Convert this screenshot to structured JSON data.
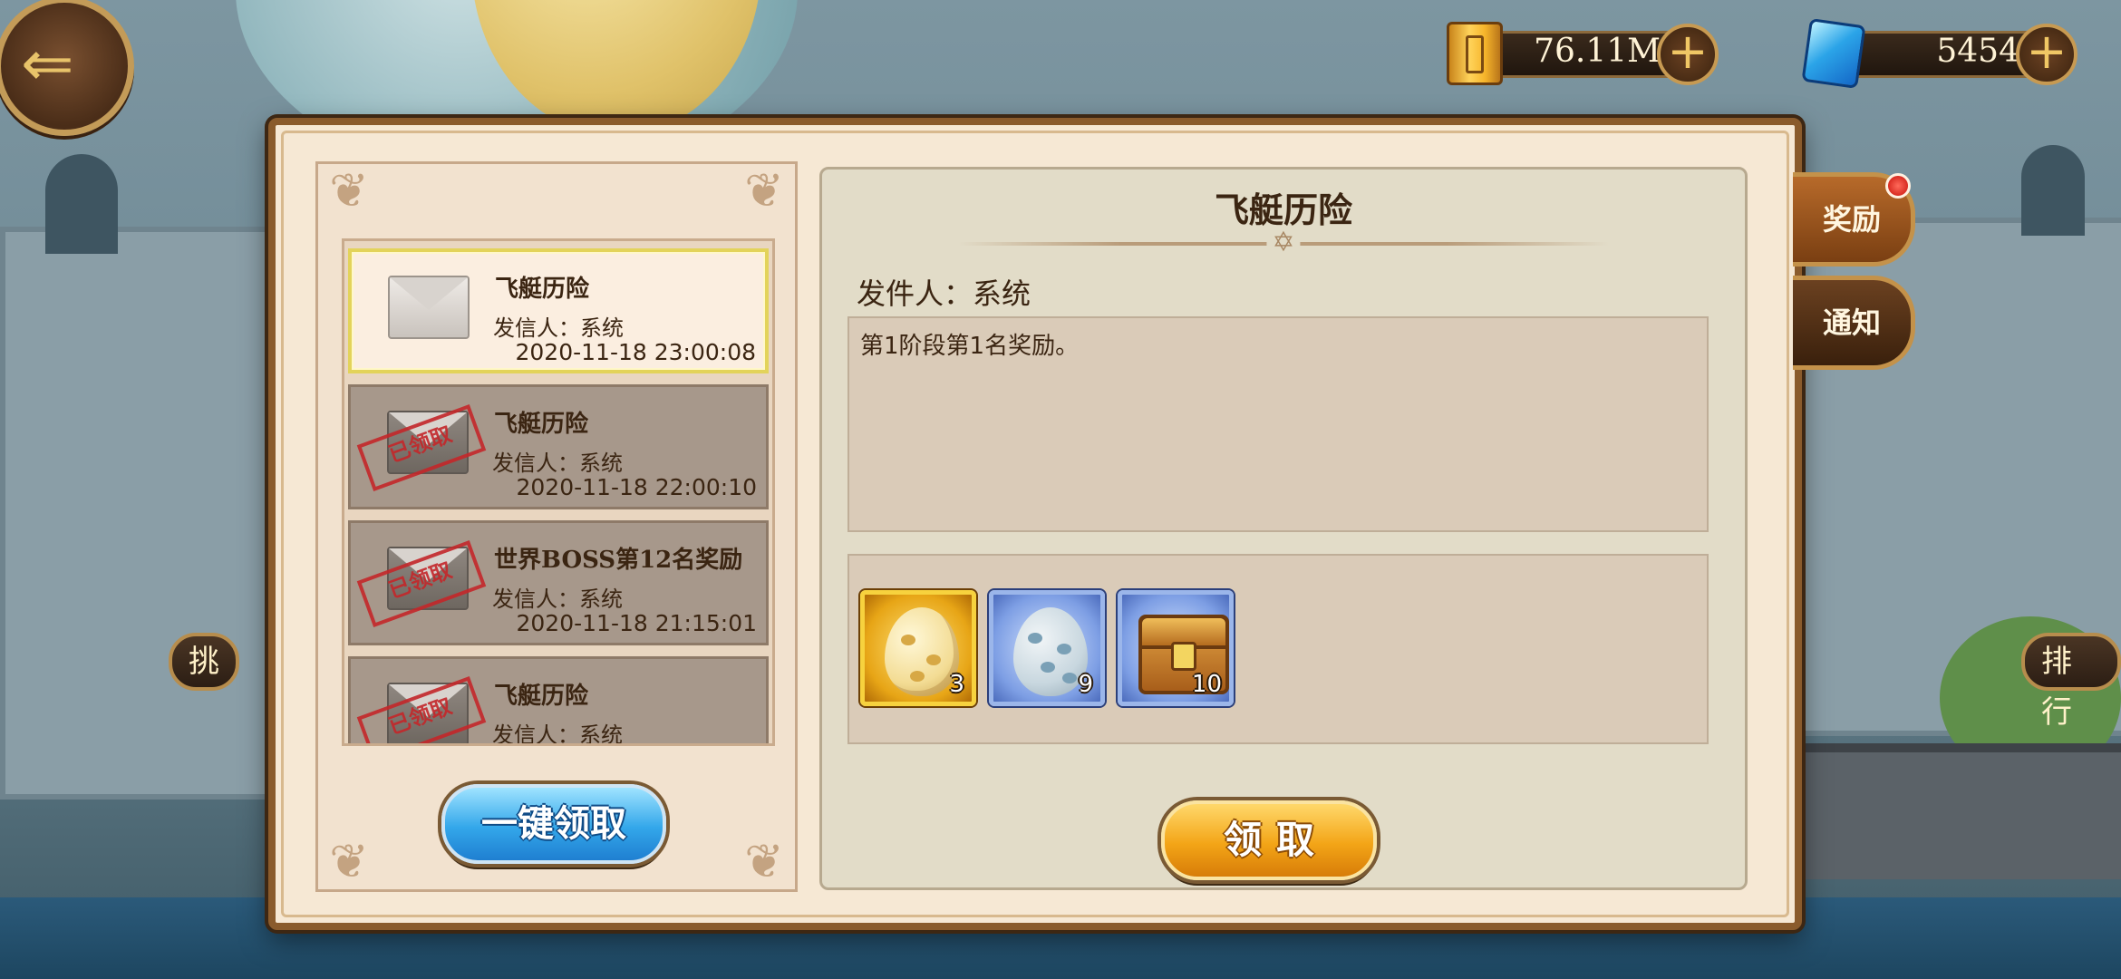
{
  "top_bar": {
    "gold": "76.11M",
    "gems": "5454",
    "gold_icon": "gold-coin-icon",
    "gem_icon": "blue-gem-icon",
    "plus_symbol": "+",
    "back_symbol": "⇐"
  },
  "background_labels": {
    "left_btn": "挑",
    "right_btn": "排行"
  },
  "mail_list": {
    "stamp_text": "已领取",
    "items": [
      {
        "title": "飞艇历险",
        "sender": "发信人：系统",
        "time": "2020-11-18 23:00:08",
        "claimed": false
      },
      {
        "title": "飞艇历险",
        "sender": "发信人：系统",
        "time": "2020-11-18 22:00:10",
        "claimed": true
      },
      {
        "title": "世界BOSS第12名奖励",
        "sender": "发信人：系统",
        "time": "2020-11-18 21:15:01",
        "claimed": true
      },
      {
        "title": "飞艇历险",
        "sender": "发信人：系统",
        "time": "",
        "claimed": true
      }
    ]
  },
  "buttons": {
    "collect_all": "一键领取",
    "collect": "领取"
  },
  "detail": {
    "title": "飞艇历险",
    "sender": "发件人：系统",
    "body": "第1阶段第1名奖励。",
    "divider_symbol": "✡",
    "rewards": [
      {
        "name": "golden-spiky-egg",
        "count": "3",
        "frame": "gold"
      },
      {
        "name": "blue-spotted-egg",
        "count": "9",
        "frame": "blue"
      },
      {
        "name": "treasure-chest",
        "count": "10",
        "frame": "blue"
      }
    ]
  },
  "tabs": [
    {
      "label": "奖励",
      "active": true,
      "badge": true
    },
    {
      "label": "通知",
      "active": false,
      "badge": false
    }
  ],
  "colors": {
    "dialog_bg": "#f6e8d4",
    "active_mail_border": "#e3d35a",
    "stamp_red": "#c4272a",
    "collect_all_blue": "#33a7ea",
    "collect_orange": "#f3a517"
  }
}
